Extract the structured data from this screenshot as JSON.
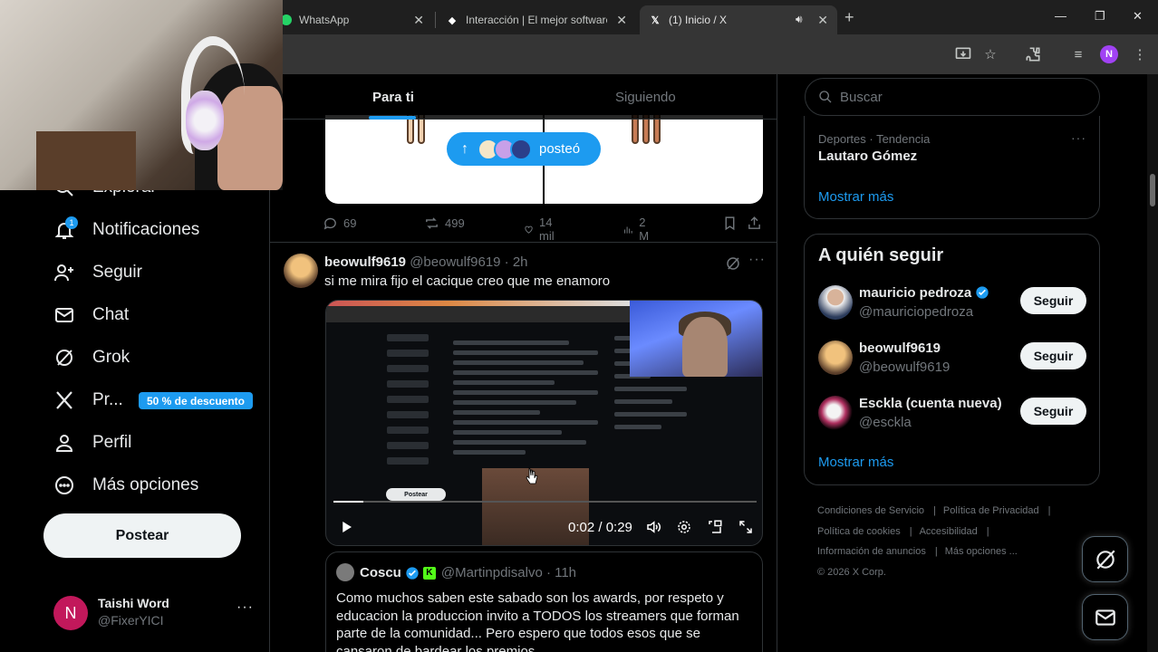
{
  "browser": {
    "tabs": [
      {
        "title": "WhatsApp"
      },
      {
        "title": "Interacción | El mejor software p"
      },
      {
        "title": "(1) Inicio / X"
      }
    ]
  },
  "nav": {
    "explore_label": "Explorar",
    "notifications_label": "Notificaciones",
    "notifications_count": "1",
    "follow_label": "Seguir",
    "chat_label": "Chat",
    "grok_label": "Grok",
    "premium_label": "Pr...",
    "premium_promo": "50 % de descuento",
    "profile_label": "Perfil",
    "more_label": "Más opciones",
    "post_button": "Postear"
  },
  "account": {
    "avatar_letter": "N",
    "name": "Taishi Word",
    "handle": "@FixerYICI",
    "more": "···"
  },
  "feed": {
    "tab_for_you": "Para ti",
    "tab_following": "Siguiendo",
    "posted_pill": "posteó"
  },
  "prev_post": {
    "replies": "69",
    "reposts": "499",
    "likes": "14 mil",
    "views": "2 M"
  },
  "post": {
    "name": "beowulf9619",
    "meta": "@beowulf9619 · 2h",
    "text": "si me mira fijo el cacique creo que me enamoro",
    "dots": "···",
    "video": {
      "time": "0:02 / 0:29",
      "progress": 0.07,
      "compose_label": "Postear"
    },
    "quote": {
      "name": "Coscu",
      "meta": "@Martinpdisalvo · 11h",
      "kick_letter": "K",
      "text": "Como muchos saben este sabado son los awards, por respeto y educacion la produccion invito a TODOS los streamers que forman parte de la comunidad... Pero espero que todos esos que se cansaron de bardear los premios"
    }
  },
  "sidebar": {
    "search_placeholder": "Buscar",
    "trend": {
      "meta": "Deportes · Tendencia",
      "name": "Lautaro Gómez",
      "dots": "···",
      "show_more": "Mostrar más"
    },
    "who_to_follow": {
      "title": "A quién seguir",
      "follow_label": "Seguir",
      "users": [
        {
          "name": "mauricio pedroza",
          "handle": "@mauriciopedroza",
          "verified": true
        },
        {
          "name": "beowulf9619",
          "handle": "@beowulf9619",
          "verified": false
        },
        {
          "name": "Esckla (cuenta nueva)",
          "handle": "@esckla",
          "verified": false
        }
      ],
      "show_more": "Mostrar más"
    },
    "footer": {
      "terms": "Condiciones de Servicio",
      "privacy": "Política de Privacidad",
      "cookies": "Política de cookies",
      "accessibility": "Accesibilidad",
      "ads": "Información de anuncios",
      "more": "Más opciones ...",
      "copyright": "© 2026 X Corp."
    }
  },
  "colors": {
    "accent": "#1d9bf0",
    "background": "#000000",
    "border": "#2f3336",
    "muted_text": "#71767b"
  }
}
